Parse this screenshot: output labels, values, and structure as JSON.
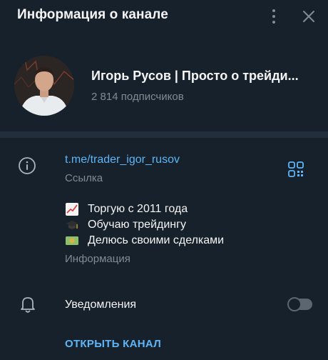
{
  "header": {
    "title": "Информация о канале",
    "menu_icon": "more-vertical-icon",
    "close_icon": "close-icon"
  },
  "profile": {
    "name": "Игорь Русов | Просто о трейди...",
    "subscribers": "2 814 подписчиков"
  },
  "link_section": {
    "icon": "info-icon",
    "link": "t.me/trader_igor_rusov",
    "caption": "Ссылка",
    "qr_icon": "qr-code-icon"
  },
  "description": {
    "lines": [
      {
        "emoji": "chart-increasing-icon",
        "text": "Торгую с 2011 года"
      },
      {
        "emoji": "graduation-cap-icon",
        "text": "Обучаю трейдингу"
      },
      {
        "emoji": "money-icon",
        "text": "Делюсь своими сделками"
      }
    ],
    "caption": "Информация"
  },
  "notifications": {
    "icon": "bell-icon",
    "label": "Уведомления",
    "enabled": false
  },
  "open_channel": {
    "label": "ОТКРЫТЬ КАНАЛ"
  },
  "colors": {
    "background": "#17212b",
    "accent": "#5eb5f7",
    "muted": "#7f8b96",
    "divider": "#232e3c"
  }
}
